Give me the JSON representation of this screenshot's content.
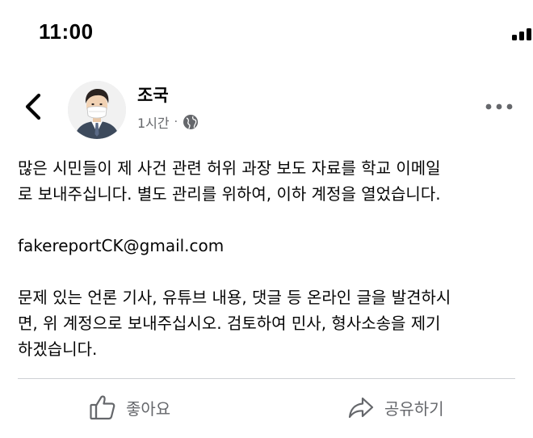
{
  "status_bar": {
    "time": "11:00",
    "icons": [
      "signal-icon",
      "wifi-icon",
      "battery-charging-icon"
    ],
    "battery_color": "#34c759"
  },
  "post": {
    "author": "조국",
    "time_ago": "1시간",
    "separator": "·",
    "privacy_icon": "globe-icon",
    "paragraphs": [
      [
        "많은 시민들이 제 사건 관련 허위 과장 보도 자료를 학교 이메일",
        "로 보내주십니다. 별도 관리를 위하여, 이하 계정을 열었습니다."
      ],
      [
        "fakereportCK@gmail.com"
      ],
      [
        "문제 있는 언론 기사, 유튜브 내용, 댓글 등 온라인 글을 발견하시",
        "면, 위 계정으로 보내주십시오. 검토하여 민사, 형사소송을 제기",
        "하겠습니다."
      ]
    ]
  },
  "actions": {
    "like_label": "좋아요",
    "share_label": "공유하기"
  },
  "colors": {
    "text_primary": "#050505",
    "text_secondary": "#65676b",
    "divider": "#ced0d4"
  }
}
